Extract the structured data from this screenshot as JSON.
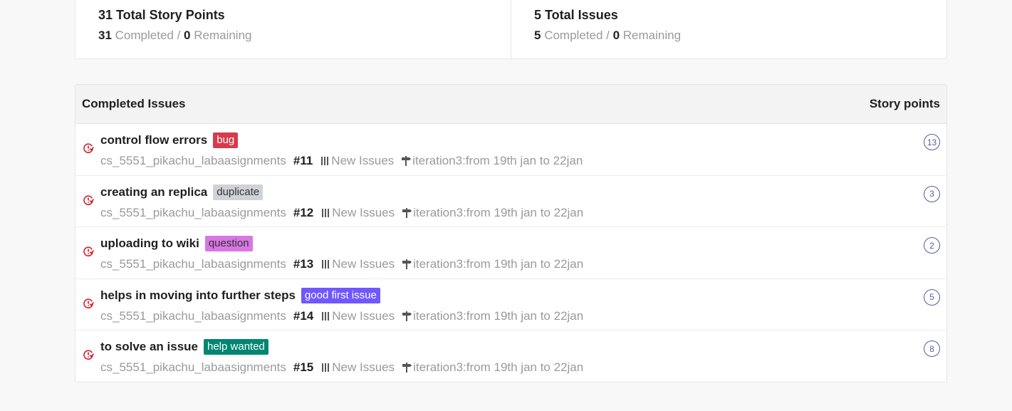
{
  "summary": {
    "story_points": {
      "title": "31 Total Story Points",
      "completed_value": "31",
      "completed_label": " Completed / ",
      "remaining_value": "0",
      "remaining_label": " Remaining"
    },
    "issues": {
      "title": "5 Total Issues",
      "completed_value": "5",
      "completed_label": " Completed / ",
      "remaining_value": "0",
      "remaining_label": " Remaining"
    }
  },
  "table": {
    "header_left": "Completed Issues",
    "header_right": "Story points",
    "rows": [
      {
        "title": "control flow errors",
        "label": "bug",
        "label_bg": "#d73a4a",
        "label_fg": "#ffffff",
        "repo": "cs_5551_pikachu_labaasignments",
        "number": "#11",
        "board": "New Issues",
        "milestone": "iteration3:from 19th jan to 22jan",
        "points": "13"
      },
      {
        "title": "creating an replica",
        "label": "duplicate",
        "label_bg": "#cfd3d7",
        "label_fg": "#333333",
        "repo": "cs_5551_pikachu_labaasignments",
        "number": "#12",
        "board": "New Issues",
        "milestone": "iteration3:from 19th jan to 22jan",
        "points": "3"
      },
      {
        "title": "uploading to wiki",
        "label": "question",
        "label_bg": "#d876e3",
        "label_fg": "#333333",
        "repo": "cs_5551_pikachu_labaasignments",
        "number": "#13",
        "board": "New Issues",
        "milestone": "iteration3:from 19th jan to 22jan",
        "points": "2"
      },
      {
        "title": "helps in moving into further steps",
        "label": "good first issue",
        "label_bg": "#7057ff",
        "label_fg": "#ffffff",
        "repo": "cs_5551_pikachu_labaasignments",
        "number": "#14",
        "board": "New Issues",
        "milestone": "iteration3:from 19th jan to 22jan",
        "points": "5"
      },
      {
        "title": "to solve an issue",
        "label": "help wanted",
        "label_bg": "#008672",
        "label_fg": "#ffffff",
        "repo": "cs_5551_pikachu_labaasignments",
        "number": "#15",
        "board": "New Issues",
        "milestone": "iteration3:from 19th jan to 22jan",
        "points": "8"
      }
    ]
  },
  "colors": {
    "closed_icon": "#cb2431",
    "points_circle": "#5a5a9a"
  },
  "icons": {
    "issue": "closed-issue-icon",
    "board": "board-columns-icon",
    "milestone": "milestone-signpost-icon"
  }
}
